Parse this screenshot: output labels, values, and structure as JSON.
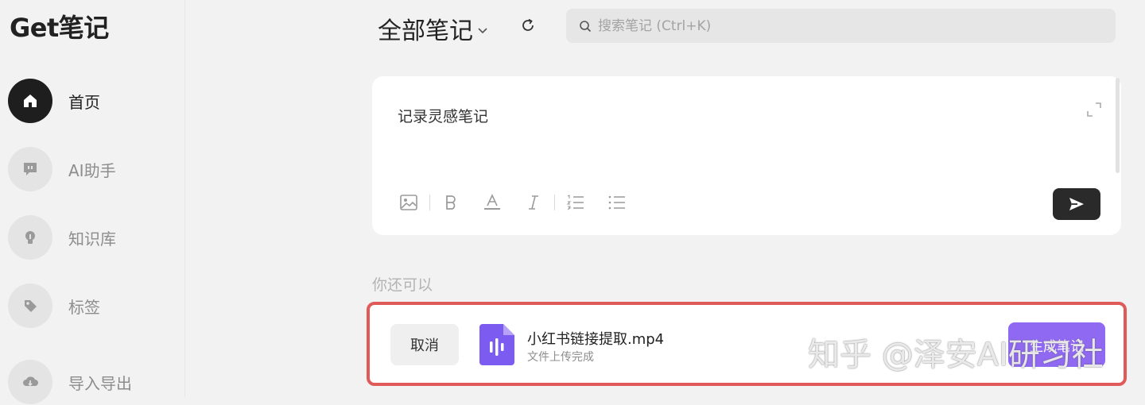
{
  "app": {
    "logo": "Get笔记"
  },
  "sidebar": {
    "items": [
      {
        "label": "首页",
        "icon": "home-icon",
        "active": true
      },
      {
        "label": "AI助手",
        "icon": "chat-bubble-icon",
        "active": false
      },
      {
        "label": "知识库",
        "icon": "lightbulb-icon",
        "active": false
      },
      {
        "label": "标签",
        "icon": "tag-icon",
        "active": false
      },
      {
        "label": "导入导出",
        "icon": "cloud-transfer-icon",
        "active": false
      }
    ]
  },
  "header": {
    "title": "全部笔记",
    "search_placeholder": "搜索笔记 (Ctrl+K)"
  },
  "editor": {
    "placeholder": "记录灵感笔记",
    "toolbar": [
      "image-icon",
      "bold-icon",
      "font-color-icon",
      "italic-icon",
      "ordered-list-icon",
      "bullet-list-icon"
    ]
  },
  "section": {
    "label": "你还可以"
  },
  "upload": {
    "cancel_label": "取消",
    "file_name": "小红书链接提取.mp4",
    "status": "文件上传完成",
    "action_label": "生成笔记"
  },
  "watermark": "知乎 @泽安AI研习社",
  "colors": {
    "accent": "#9069f2",
    "highlight_border": "#e05a5a",
    "active_nav": "#1e1e1e"
  }
}
